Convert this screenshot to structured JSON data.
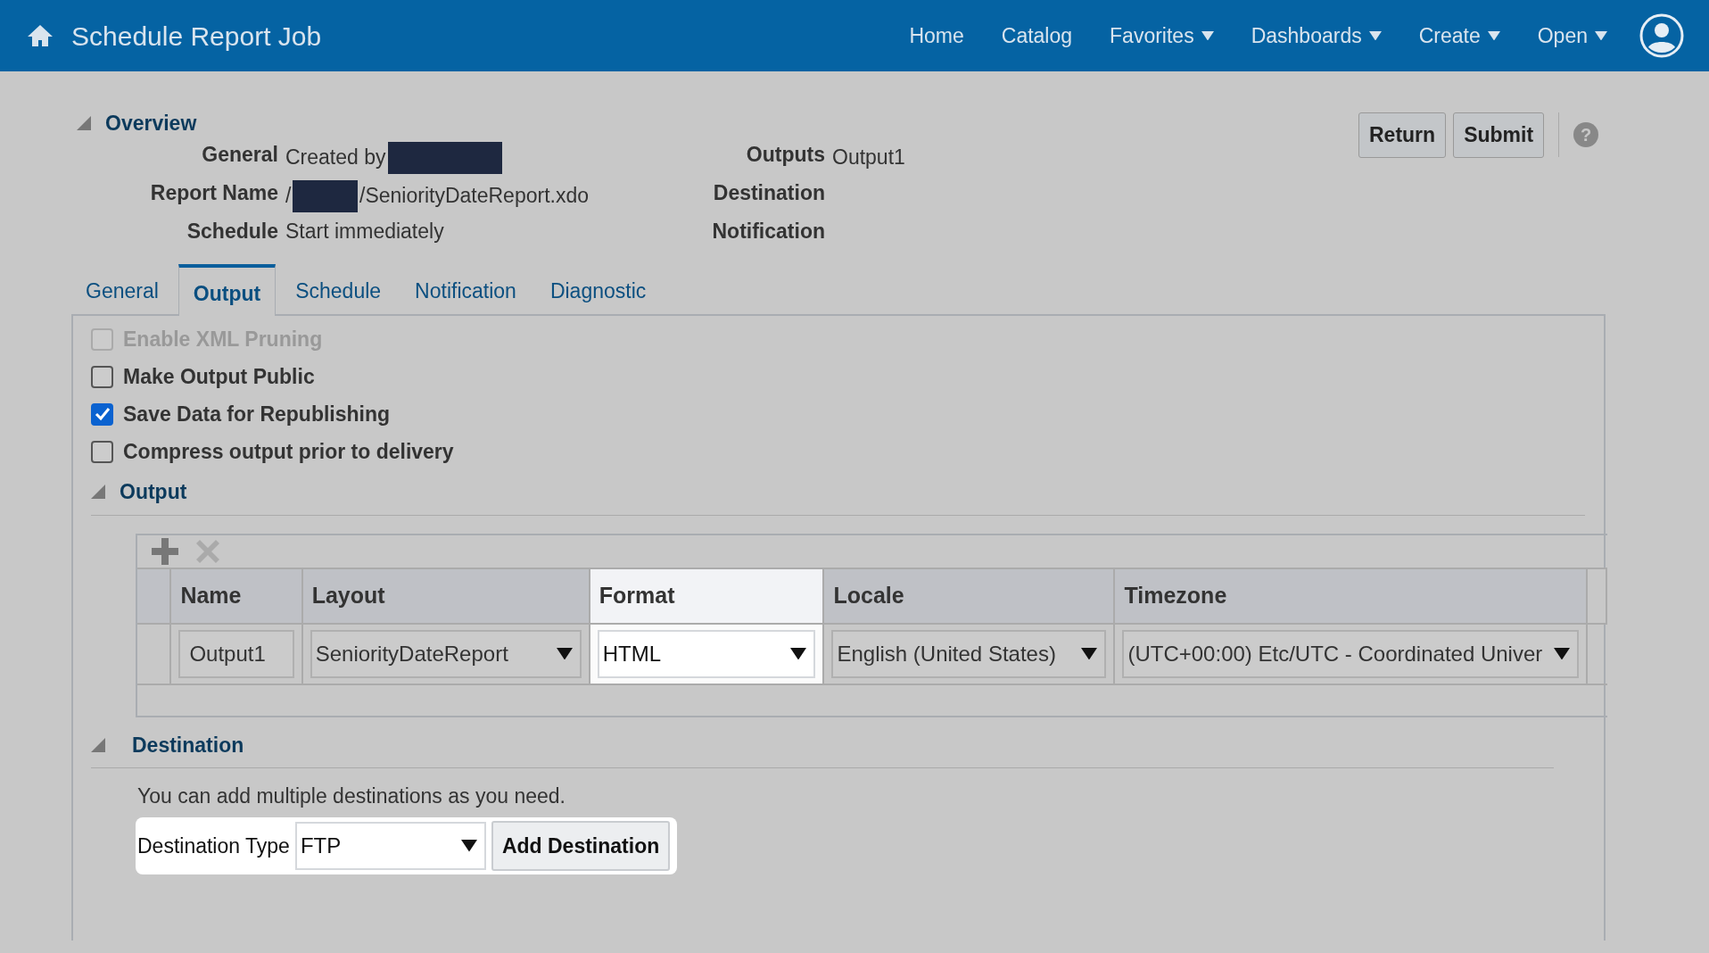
{
  "header": {
    "title": "Schedule Report Job",
    "nav": [
      {
        "label": "Home",
        "dropdown": false
      },
      {
        "label": "Catalog",
        "dropdown": false
      },
      {
        "label": "Favorites",
        "dropdown": true
      },
      {
        "label": "Dashboards",
        "dropdown": true
      },
      {
        "label": "Create",
        "dropdown": true
      },
      {
        "label": "Open",
        "dropdown": true
      }
    ]
  },
  "overview": {
    "title": "Overview",
    "expanded": true,
    "left": [
      {
        "label": "General",
        "prefix": "Created by",
        "redacted": true
      },
      {
        "label": "Report Name",
        "prefix": "/",
        "redacted": true,
        "value": "/SeniorityDateReport.xdo"
      },
      {
        "label": "Schedule",
        "prefix": "Start immediately",
        "redacted": false
      }
    ],
    "right": [
      {
        "label": "Outputs",
        "value": "Output1"
      },
      {
        "label": "Destination"
      },
      {
        "label": "Notification"
      }
    ]
  },
  "buttons": [
    "Return",
    "Submit"
  ],
  "help": "?",
  "tabs": [
    {
      "label": "General",
      "selected": false
    },
    {
      "label": "Output",
      "selected": true
    },
    {
      "label": "Schedule",
      "selected": false
    },
    {
      "label": "Notification",
      "selected": false
    },
    {
      "label": "Diagnostic",
      "selected": false
    }
  ],
  "options": [
    {
      "label": "Enable XML Pruning",
      "checked": false,
      "disabled": true
    },
    {
      "label": "Make Output Public",
      "checked": false,
      "disabled": false
    },
    {
      "label": "Save Data for Republishing",
      "checked": true,
      "disabled": false
    },
    {
      "label": "Compress output prior to delivery",
      "checked": false,
      "disabled": false
    }
  ],
  "output_section": {
    "title": "Output",
    "expanded": true,
    "columns": [
      {
        "label": "Name",
        "highlighted": false
      },
      {
        "label": "Layout",
        "highlighted": false
      },
      {
        "label": "Format",
        "highlighted": true
      },
      {
        "label": "Locale",
        "highlighted": false
      },
      {
        "label": "Timezone",
        "highlighted": false
      }
    ],
    "rows": [
      [
        {
          "kind": "text",
          "value": "Output1"
        },
        {
          "kind": "select",
          "value": "SeniorityDateReport"
        },
        {
          "kind": "select",
          "value": "HTML"
        },
        {
          "kind": "select",
          "value": "English (United States)"
        },
        {
          "kind": "select",
          "value": "(UTC+00:00) Etc/UTC - Coordinated Univer"
        }
      ]
    ]
  },
  "destination_section": {
    "title": "Destination",
    "expanded": true,
    "hint": "You can add multiple destinations as you need.",
    "type_label": "Destination Type",
    "type_value": "FTP",
    "button": "Add Destination",
    "highlighted": true
  }
}
